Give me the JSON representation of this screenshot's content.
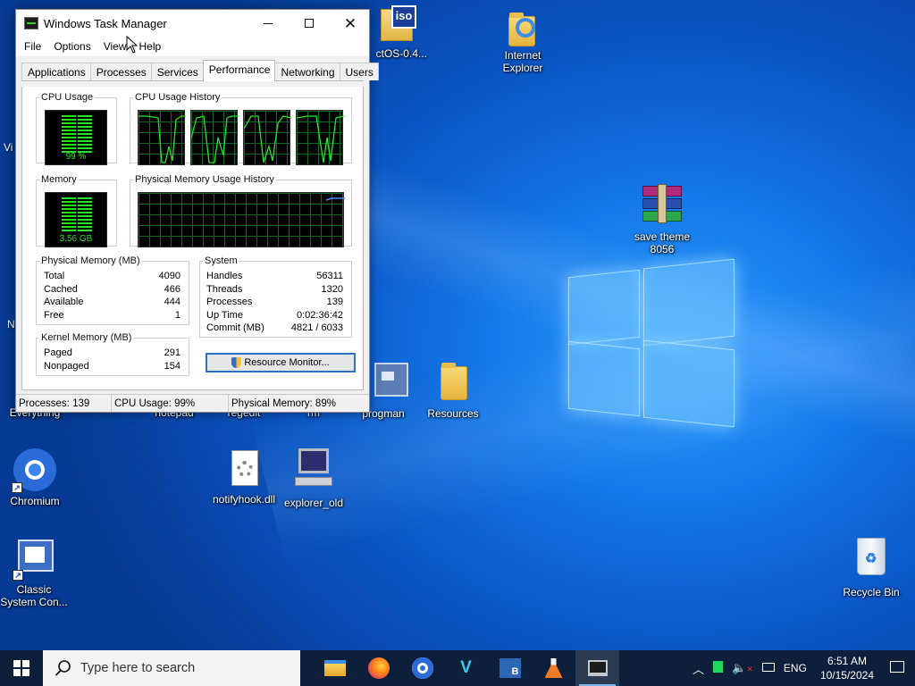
{
  "window": {
    "title": "Windows Task Manager",
    "menu": [
      "File",
      "Options",
      "View",
      "Help"
    ],
    "tabs": [
      "Applications",
      "Processes",
      "Services",
      "Performance",
      "Networking",
      "Users"
    ],
    "active_tab": "Performance"
  },
  "performance": {
    "cpu_usage_label": "CPU Usage",
    "cpu_usage_value": "99 %",
    "cpu_history_label": "CPU Usage History",
    "memory_label": "Memory",
    "memory_value": "3.56 GB",
    "memory_history_label": "Physical Memory Usage History",
    "physical_memory": {
      "label": "Physical Memory (MB)",
      "rows": [
        {
          "name": "Total",
          "value": "4090"
        },
        {
          "name": "Cached",
          "value": "466"
        },
        {
          "name": "Available",
          "value": "444"
        },
        {
          "name": "Free",
          "value": "1"
        }
      ]
    },
    "system": {
      "label": "System",
      "rows": [
        {
          "name": "Handles",
          "value": "56311"
        },
        {
          "name": "Threads",
          "value": "1320"
        },
        {
          "name": "Processes",
          "value": "139"
        },
        {
          "name": "Up Time",
          "value": "0:02:36:42"
        },
        {
          "name": "Commit (MB)",
          "value": "4821 / 6033"
        }
      ]
    },
    "kernel_memory": {
      "label": "Kernel Memory (MB)",
      "rows": [
        {
          "name": "Paged",
          "value": "291"
        },
        {
          "name": "Nonpaged",
          "value": "154"
        }
      ]
    },
    "resource_monitor_label": "Resource Monitor..."
  },
  "status": {
    "processes": "Processes: 139",
    "cpu": "CPU Usage: 99%",
    "memory": "Physical Memory: 89%"
  },
  "desktop_icons": {
    "iso_partial": "ctOS-0.4...",
    "internet_explorer": "Internet Explorer",
    "save_theme": "save theme 8056",
    "everything": "Everything",
    "notepad": "notepad",
    "regedit": "regedit",
    "rm": "rm",
    "progman": "progman",
    "resources": "Resources",
    "chromium": "Chromium",
    "notifyhook": "notifyhook.dll",
    "explorer_old": "explorer_old",
    "classic_system": "Classic System Con...",
    "recycle_bin": "Recycle Bin",
    "edge_v1": "Vi",
    "edge_n1": "N"
  },
  "taskbar": {
    "search_placeholder": "Type here to search",
    "language": "ENG",
    "time": "6:51 AM",
    "date": "10/15/2024"
  },
  "colors": {
    "meter_green": "#22e622",
    "taskbar_bg": "#0d1f3a",
    "button_accent": "#2a73c8"
  }
}
